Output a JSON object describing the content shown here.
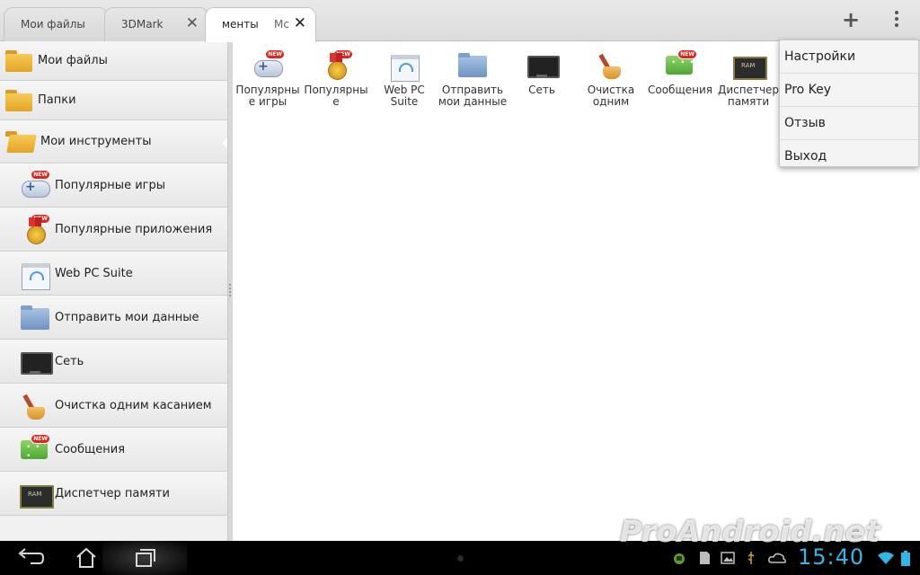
{
  "tabs": [
    {
      "label": "Мои файлы"
    },
    {
      "label": "3DMark"
    },
    {
      "label": "менты",
      "label2": "Мс"
    }
  ],
  "toolbar": {
    "add_label": "+"
  },
  "sidebar": {
    "folders": [
      {
        "label": "Мои файлы",
        "icon": "folder-icon"
      },
      {
        "label": "Папки",
        "icon": "folder-icon"
      },
      {
        "label": "Мои инструменты",
        "icon": "folder-open-icon"
      }
    ],
    "tools": [
      {
        "label": "Популярные игры",
        "icon": "games-icon",
        "badge": "NEW"
      },
      {
        "label": "Популярные приложения",
        "icon": "apps-medal-icon",
        "badge": "NEW"
      },
      {
        "label": "Web PC Suite",
        "icon": "web-pc-suite-icon"
      },
      {
        "label": "Отправить мои данные",
        "icon": "send-data-icon"
      },
      {
        "label": "Сеть",
        "icon": "network-monitor-icon"
      },
      {
        "label": "Очистка одним касанием",
        "icon": "broom-icon"
      },
      {
        "label": "Сообщения",
        "icon": "messages-icon",
        "badge": "NEW"
      },
      {
        "label": "Диспетчер памяти",
        "icon": "ram-icon"
      }
    ]
  },
  "grid": [
    {
      "label": "Популярные игры",
      "icon": "games-icon",
      "badge": "NEW"
    },
    {
      "label": "Популярные",
      "icon": "apps-medal-icon",
      "badge": "NEW"
    },
    {
      "label": "Web PC Suite",
      "icon": "web-pc-suite-icon"
    },
    {
      "label": "Отправить мои данные",
      "icon": "send-data-icon"
    },
    {
      "label": "Сеть",
      "icon": "network-monitor-icon"
    },
    {
      "label": "Очистка одним",
      "icon": "broom-icon"
    },
    {
      "label": "Сообщения",
      "icon": "messages-icon",
      "badge": "NEW"
    },
    {
      "label": "Диспетчер памяти",
      "icon": "ram-icon"
    }
  ],
  "menu": {
    "items": [
      {
        "label": "Настройки"
      },
      {
        "label": "Pro Key"
      },
      {
        "label": "Отзыв"
      },
      {
        "label": "Выход"
      }
    ]
  },
  "status": {
    "clock": "15:40",
    "accent": "#33b5e5"
  },
  "watermark": "ProAndroid.net"
}
